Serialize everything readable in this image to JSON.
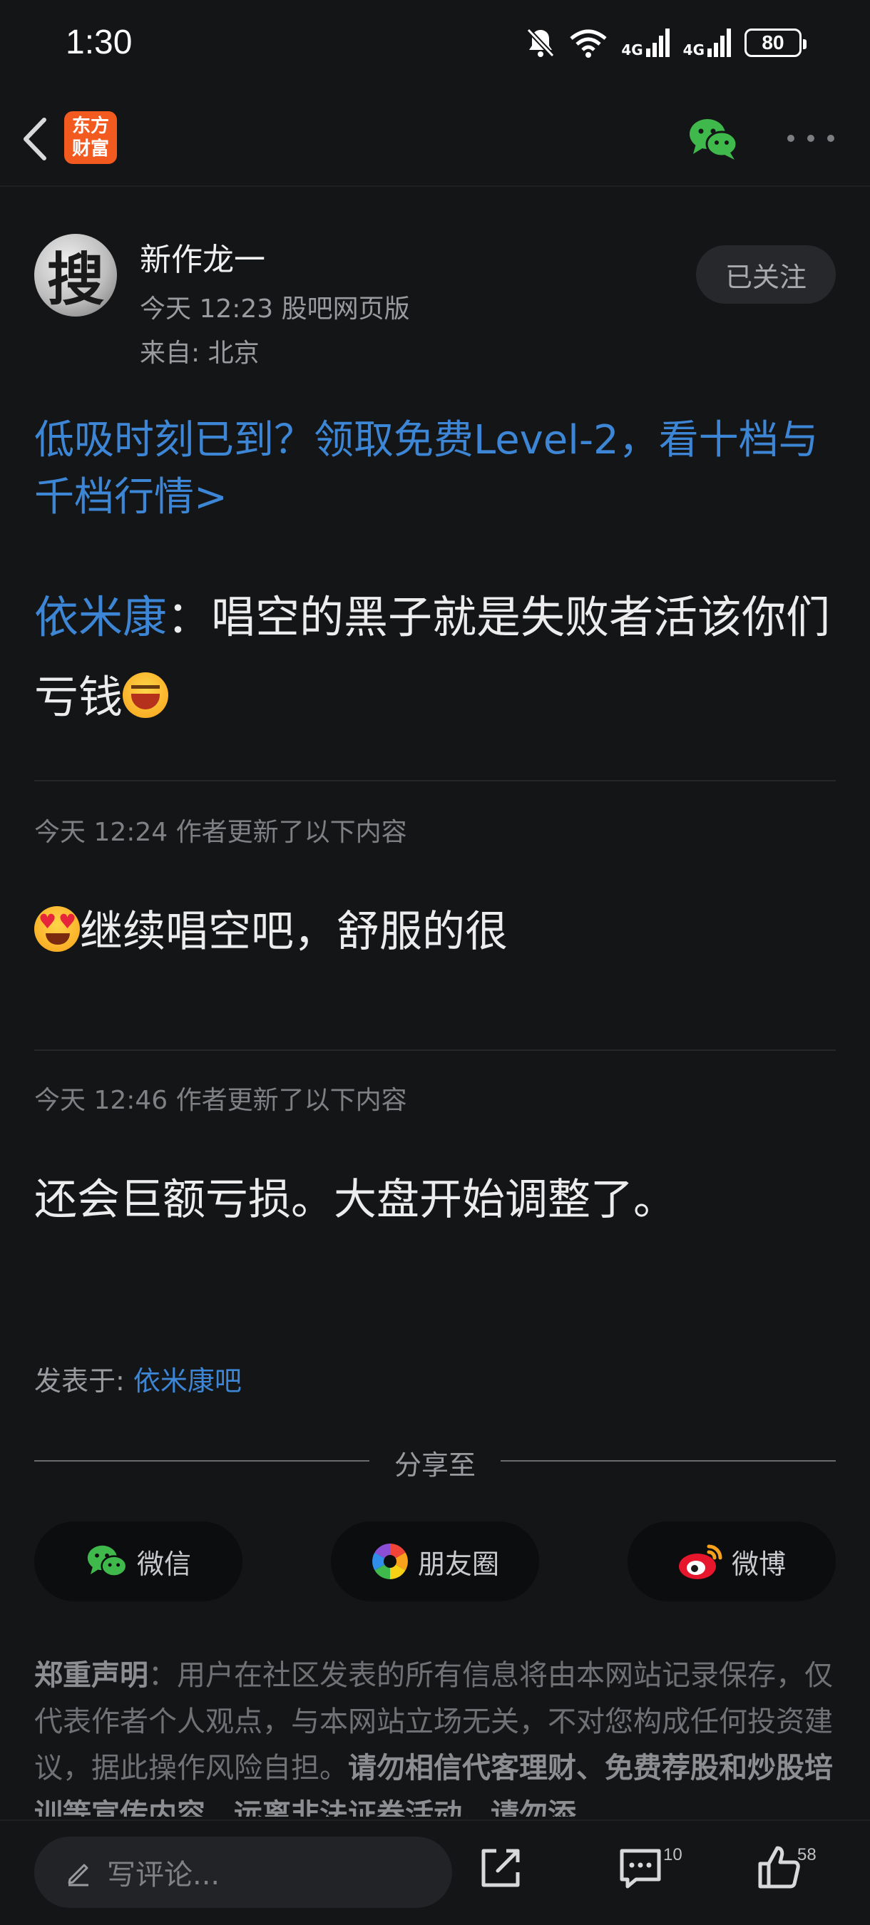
{
  "status_bar": {
    "time": "1:30",
    "network_1": "4G",
    "network_2": "4G",
    "battery": "80",
    "icons": [
      "mute-bell-icon",
      "wifi-icon",
      "signal-icon",
      "signal-icon",
      "battery-icon"
    ]
  },
  "header": {
    "logo_text": "东方财富",
    "icons": [
      "back-arrow-icon",
      "wechat-icon",
      "more-icon"
    ]
  },
  "author": {
    "avatar_char": "搜",
    "name": "新作龙一",
    "meta": "今天 12:23 股吧网页版",
    "location": "来自: 北京",
    "follow_label": "已关注"
  },
  "promo": {
    "text": "低吸时刻已到？领取免费Level-2，看十档与千档行情>"
  },
  "post": {
    "mention": "依米康",
    "colon": "：",
    "text": "唱空的黑子就是失败者活该你们亏钱",
    "emoji": "laughing-emoji"
  },
  "updates": [
    {
      "meta": "今天 12:24  作者更新了以下内容",
      "text": "继续唱空吧，舒服的很",
      "emoji": "heart-eyes-emoji"
    },
    {
      "meta": "今天 12:46  作者更新了以下内容",
      "text": "还会巨额亏损。大盘开始调整了。"
    }
  ],
  "posted_in": {
    "label": "发表于: ",
    "bar_name": "依米康吧"
  },
  "share": {
    "title": "分享至",
    "buttons": [
      {
        "label": "微信",
        "icon": "wechat-icon"
      },
      {
        "label": "朋友圈",
        "icon": "moments-icon"
      },
      {
        "label": "微博",
        "icon": "weibo-icon"
      }
    ]
  },
  "disclaimer": {
    "heading": "郑重声明",
    "body": "：用户在社区发表的所有信息将由本网站记录保存，仅代表作者个人观点，与本网站立场无关，不对您构成任何投资建议，据此操作风险自担。",
    "bold_tail": "请勿相信代客理财、免费荐股和炒股培训等宣传内容，远离非法证券活动。请勿添"
  },
  "bottom_bar": {
    "comment_placeholder": "写评论...",
    "comment_count": "10",
    "like_count": "58",
    "icons": [
      "pencil-icon",
      "share-icon",
      "comment-icon",
      "like-icon"
    ]
  }
}
